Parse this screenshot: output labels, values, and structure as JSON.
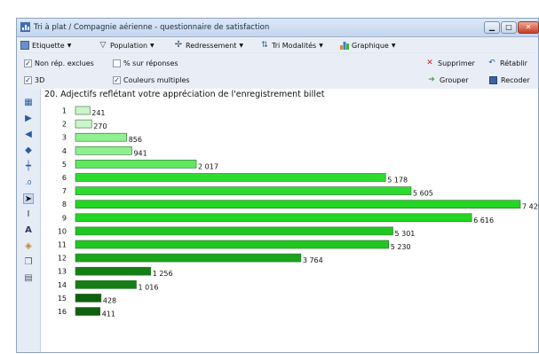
{
  "window": {
    "title": "Tri à plat / Compagnie aérienne - questionnaire de satisfaction",
    "icons": [
      "app-icon",
      "minimize-icon",
      "maximize-icon",
      "close-icon"
    ]
  },
  "menubar": {
    "items": [
      {
        "label": "Etiquette",
        "icon": "label-icon"
      },
      {
        "label": "Population",
        "icon": "filter-icon"
      },
      {
        "label": "Redressement",
        "icon": "weighting-icon"
      },
      {
        "label": "Tri Modalités",
        "icon": "sort-icon"
      },
      {
        "label": "Graphique",
        "icon": "bar-chart-icon"
      }
    ]
  },
  "options": {
    "non_rep_exclues": {
      "label": "Non rép. exclues",
      "checked": true
    },
    "pct_sur_reponses": {
      "label": "% sur réponses",
      "checked": false
    },
    "three_d": {
      "label": "3D",
      "checked": true
    },
    "couleurs_multiples": {
      "label": "Couleurs multiples",
      "checked": true
    }
  },
  "actions": {
    "supprimer": "Supprimer",
    "retablir": "Rétablir",
    "grouper": "Grouper",
    "recoder": "Recoder"
  },
  "question": {
    "title": "20. Adjectifs reflétant votre appréciation de l'enregistrement billet"
  },
  "chart_data": {
    "type": "bar",
    "orientation": "horizontal",
    "categories": [
      "1",
      "2",
      "3",
      "4",
      "5",
      "6",
      "7",
      "8",
      "9",
      "10",
      "11",
      "12",
      "13",
      "14",
      "15",
      "16"
    ],
    "values": [
      241,
      270,
      856,
      941,
      2017,
      5178,
      5605,
      7429,
      6616,
      5301,
      5230,
      3764,
      1256,
      1016,
      428,
      411
    ],
    "value_labels": [
      "241",
      "270",
      "856",
      "941",
      "2 017",
      "5 178",
      "5 605",
      "7 429",
      "6 616",
      "5 301",
      "5 230",
      "3 764",
      "1 256",
      "1 016",
      "428",
      "411"
    ],
    "colors": [
      "#ccf5cc",
      "#ccf5cc",
      "#8ef08e",
      "#8ef08e",
      "#5fe85f",
      "#2edc2e",
      "#2edc2e",
      "#22d622",
      "#22d622",
      "#1fc81f",
      "#1fc81f",
      "#1aa51a",
      "#157f15",
      "#157f15",
      "#0f610f",
      "#0f610f"
    ]
  }
}
